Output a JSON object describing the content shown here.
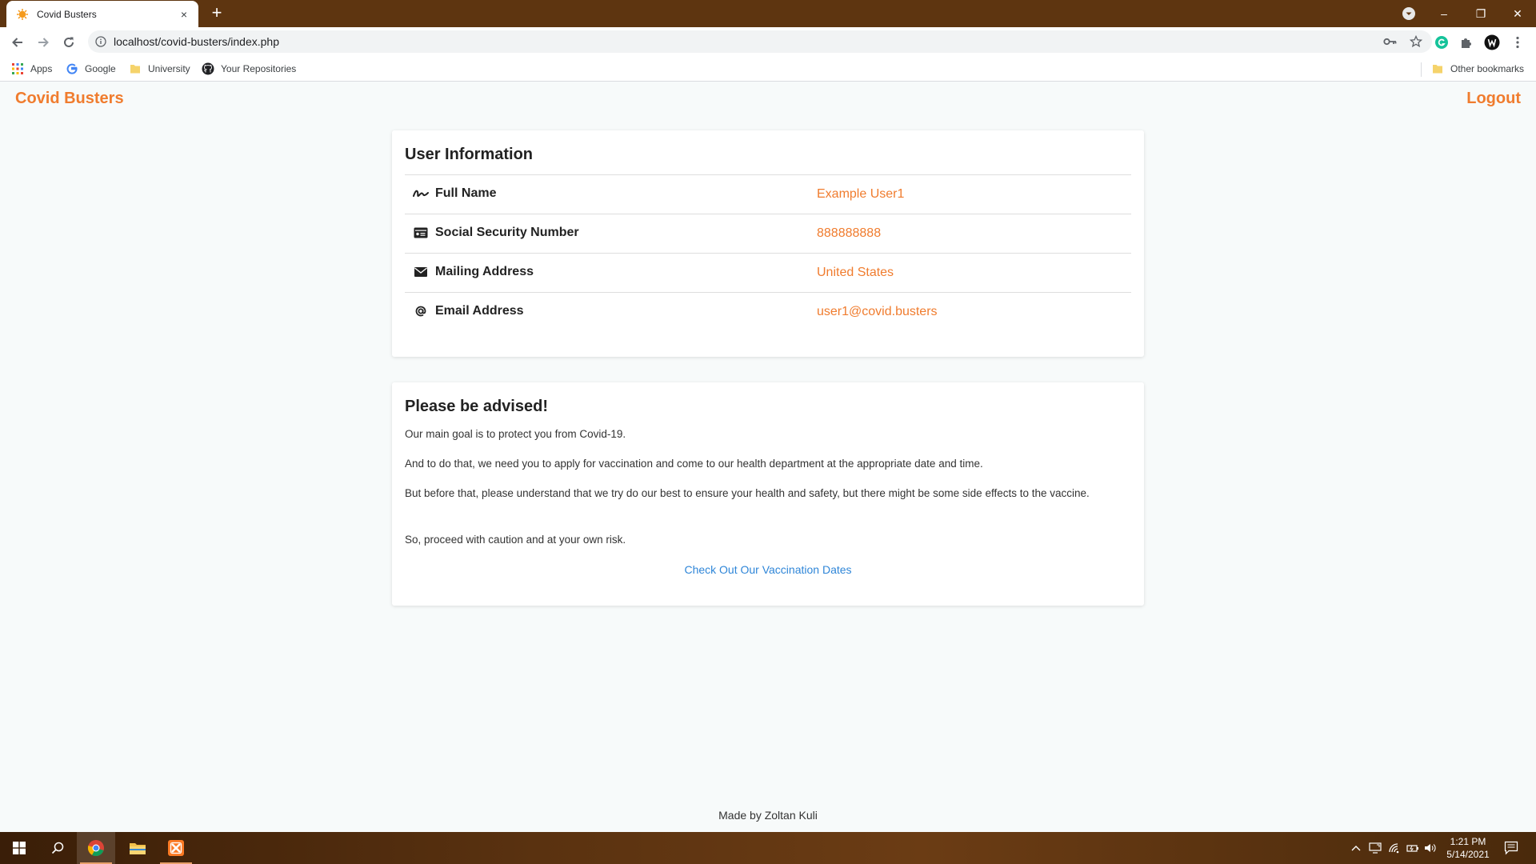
{
  "browser": {
    "tab_title": "Covid Busters",
    "tab_close": "×",
    "new_tab": "+",
    "url": "localhost/covid-busters/index.php",
    "window_controls": {
      "minimize": "–",
      "restore": "❐",
      "close": "✕"
    },
    "bookmarks": [
      {
        "label": "Apps",
        "icon": "apps-grid-icon"
      },
      {
        "label": "Google",
        "icon": "google-icon"
      },
      {
        "label": "University",
        "icon": "folder-icon"
      },
      {
        "label": "Your Repositories",
        "icon": "github-icon"
      }
    ],
    "other_bookmarks": "Other bookmarks"
  },
  "header": {
    "brand": "Covid Busters",
    "logout": "Logout"
  },
  "user_info": {
    "title": "User Information",
    "rows": [
      {
        "label": "Full Name",
        "value": "Example User1",
        "icon": "signature-icon"
      },
      {
        "label": "Social Security Number",
        "value": "888888888",
        "icon": "id-card-icon"
      },
      {
        "label": "Mailing Address",
        "value": "United States",
        "icon": "envelope-icon"
      },
      {
        "label": "Email Address",
        "value": "user1@covid.busters",
        "icon": "at-icon"
      }
    ]
  },
  "advice": {
    "title": "Please be advised!",
    "paragraphs": [
      "Our main goal is to protect you from Covid-19.",
      "And to do that, we need you to apply for vaccination and come to our health department at the appropriate date and time.",
      "But before that, please understand that we try do our best to ensure your health and safety, but there might be some side effects to the vaccine.",
      "So, proceed with caution and at your own risk."
    ],
    "link": "Check Out Our Vaccination Dates"
  },
  "footer": {
    "text": "Made by Zoltan Kuli"
  },
  "taskbar": {
    "time": "1:21 PM",
    "date": "5/14/2021"
  },
  "colors": {
    "accent": "#f07c2e",
    "link": "#2f86d8",
    "chrome_frame": "#5e3510"
  }
}
